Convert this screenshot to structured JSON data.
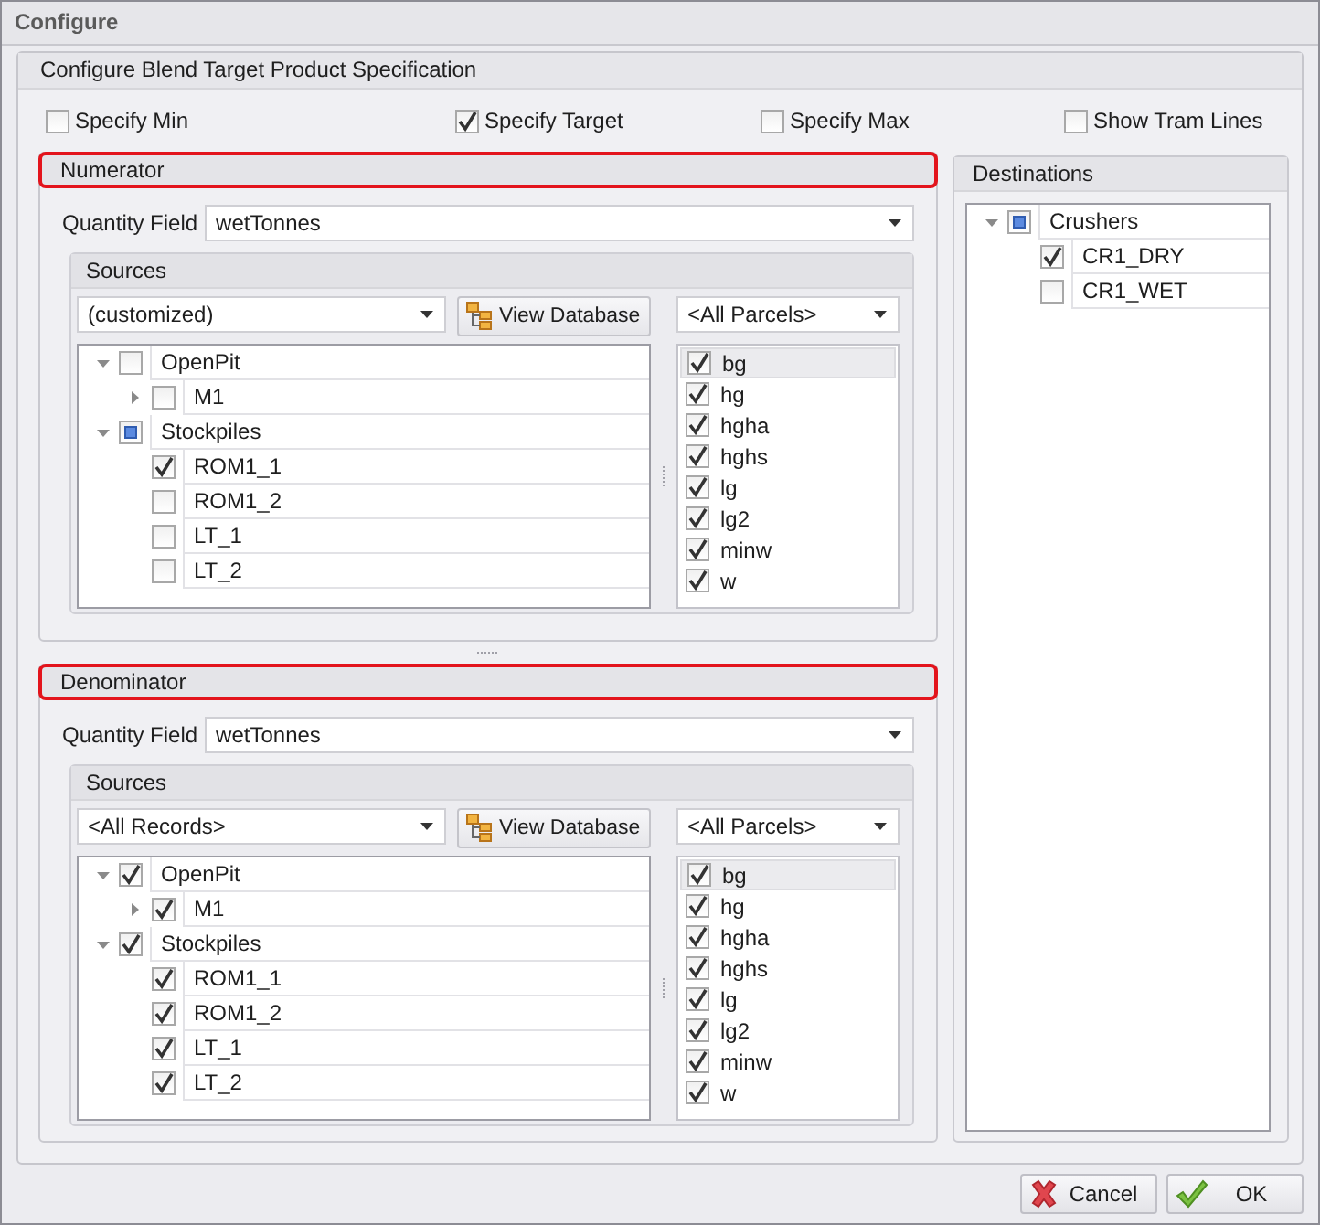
{
  "window": {
    "title": "Configure"
  },
  "group": {
    "title": "Configure Blend Target Product Specification"
  },
  "options": [
    {
      "label": "Specify Min",
      "checked": false
    },
    {
      "label": "Specify Target",
      "checked": true
    },
    {
      "label": "Specify Max",
      "checked": false
    },
    {
      "label": "Show Tram Lines",
      "checked": false
    }
  ],
  "sections": [
    {
      "title": "Numerator",
      "highlighted": true,
      "quantity_label": "Quantity Field",
      "quantity_value": "wetTonnes",
      "sources": {
        "title": "Sources",
        "filter": "(customized)",
        "view_button": "View Database",
        "parcel_filter": "<All Parcels>",
        "tree": [
          {
            "label": "OpenPit",
            "checked": false,
            "partial": false,
            "expanded": true,
            "children": [
              {
                "label": "M1",
                "checked": false,
                "partial": false,
                "expanded": false
              }
            ]
          },
          {
            "label": "Stockpiles",
            "checked": false,
            "partial": true,
            "expanded": true,
            "children": [
              {
                "label": "ROM1_1",
                "checked": true,
                "partial": false
              },
              {
                "label": "ROM1_2",
                "checked": false,
                "partial": false
              },
              {
                "label": "LT_1",
                "checked": false,
                "partial": false
              },
              {
                "label": "LT_2",
                "checked": false,
                "partial": false
              }
            ]
          }
        ],
        "parcels": [
          {
            "label": "bg",
            "checked": true,
            "selected": true
          },
          {
            "label": "hg",
            "checked": true,
            "selected": false
          },
          {
            "label": "hgha",
            "checked": true,
            "selected": false
          },
          {
            "label": "hghs",
            "checked": true,
            "selected": false
          },
          {
            "label": "lg",
            "checked": true,
            "selected": false
          },
          {
            "label": "lg2",
            "checked": true,
            "selected": false
          },
          {
            "label": "minw",
            "checked": true,
            "selected": false
          },
          {
            "label": "w",
            "checked": true,
            "selected": false
          }
        ]
      }
    },
    {
      "title": "Denominator",
      "highlighted": true,
      "quantity_label": "Quantity Field",
      "quantity_value": "wetTonnes",
      "sources": {
        "title": "Sources",
        "filter": "<All Records>",
        "view_button": "View Database",
        "parcel_filter": "<All Parcels>",
        "tree": [
          {
            "label": "OpenPit",
            "checked": true,
            "partial": false,
            "expanded": true,
            "children": [
              {
                "label": "M1",
                "checked": true,
                "partial": false,
                "expanded": false
              }
            ]
          },
          {
            "label": "Stockpiles",
            "checked": true,
            "partial": false,
            "expanded": true,
            "children": [
              {
                "label": "ROM1_1",
                "checked": true,
                "partial": false
              },
              {
                "label": "ROM1_2",
                "checked": true,
                "partial": false
              },
              {
                "label": "LT_1",
                "checked": true,
                "partial": false
              },
              {
                "label": "LT_2",
                "checked": true,
                "partial": false
              }
            ]
          }
        ],
        "parcels": [
          {
            "label": "bg",
            "checked": true,
            "selected": true
          },
          {
            "label": "hg",
            "checked": true,
            "selected": false
          },
          {
            "label": "hgha",
            "checked": true,
            "selected": false
          },
          {
            "label": "hghs",
            "checked": true,
            "selected": false
          },
          {
            "label": "lg",
            "checked": true,
            "selected": false
          },
          {
            "label": "lg2",
            "checked": true,
            "selected": false
          },
          {
            "label": "minw",
            "checked": true,
            "selected": false
          },
          {
            "label": "w",
            "checked": true,
            "selected": false
          }
        ]
      }
    }
  ],
  "destinations": {
    "title": "Destinations",
    "tree": [
      {
        "label": "Crushers",
        "checked": false,
        "partial": true,
        "expanded": true,
        "children": [
          {
            "label": "CR1_DRY",
            "checked": true,
            "partial": false
          },
          {
            "label": "CR1_WET",
            "checked": false,
            "partial": false
          }
        ]
      }
    ]
  },
  "buttons": [
    {
      "label": "Cancel",
      "kind": "cancel"
    },
    {
      "label": "OK",
      "kind": "ok"
    }
  ]
}
